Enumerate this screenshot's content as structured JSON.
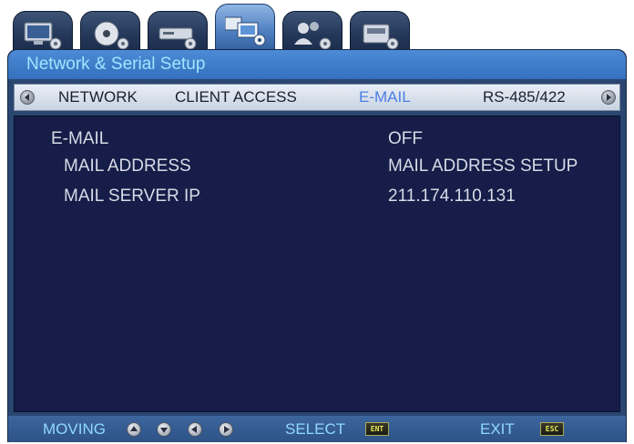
{
  "tabs": [
    {
      "icon": "monitor-settings-icon",
      "active": false
    },
    {
      "icon": "disc-settings-icon",
      "active": false
    },
    {
      "icon": "recorder-settings-icon",
      "active": false
    },
    {
      "icon": "network-settings-icon",
      "active": true
    },
    {
      "icon": "user-settings-icon",
      "active": false
    },
    {
      "icon": "system-settings-icon",
      "active": false
    }
  ],
  "title": "Network & Serial Setup",
  "subtabs": [
    "NETWORK",
    "CLIENT ACCESS",
    "E-MAIL",
    "RS-485/422"
  ],
  "active_subtab": "E-MAIL",
  "rows": {
    "email": {
      "label": "E-MAIL",
      "value": "OFF"
    },
    "mail_address": {
      "label": "MAIL ADDRESS",
      "value": "MAIL ADDRESS SETUP"
    },
    "mail_server_ip": {
      "label": "MAIL SERVER IP",
      "value": "211.174.110.131"
    }
  },
  "footer": {
    "moving": "MOVING",
    "select": "SELECT",
    "select_key": "ENT",
    "exit": "EXIT",
    "exit_key": "ESC"
  },
  "colors": {
    "title_text": "#9fe6ff",
    "active_subtab": "#4b7fe6",
    "content_bg": "#151d48",
    "footer_text": "#8fd8ff"
  }
}
